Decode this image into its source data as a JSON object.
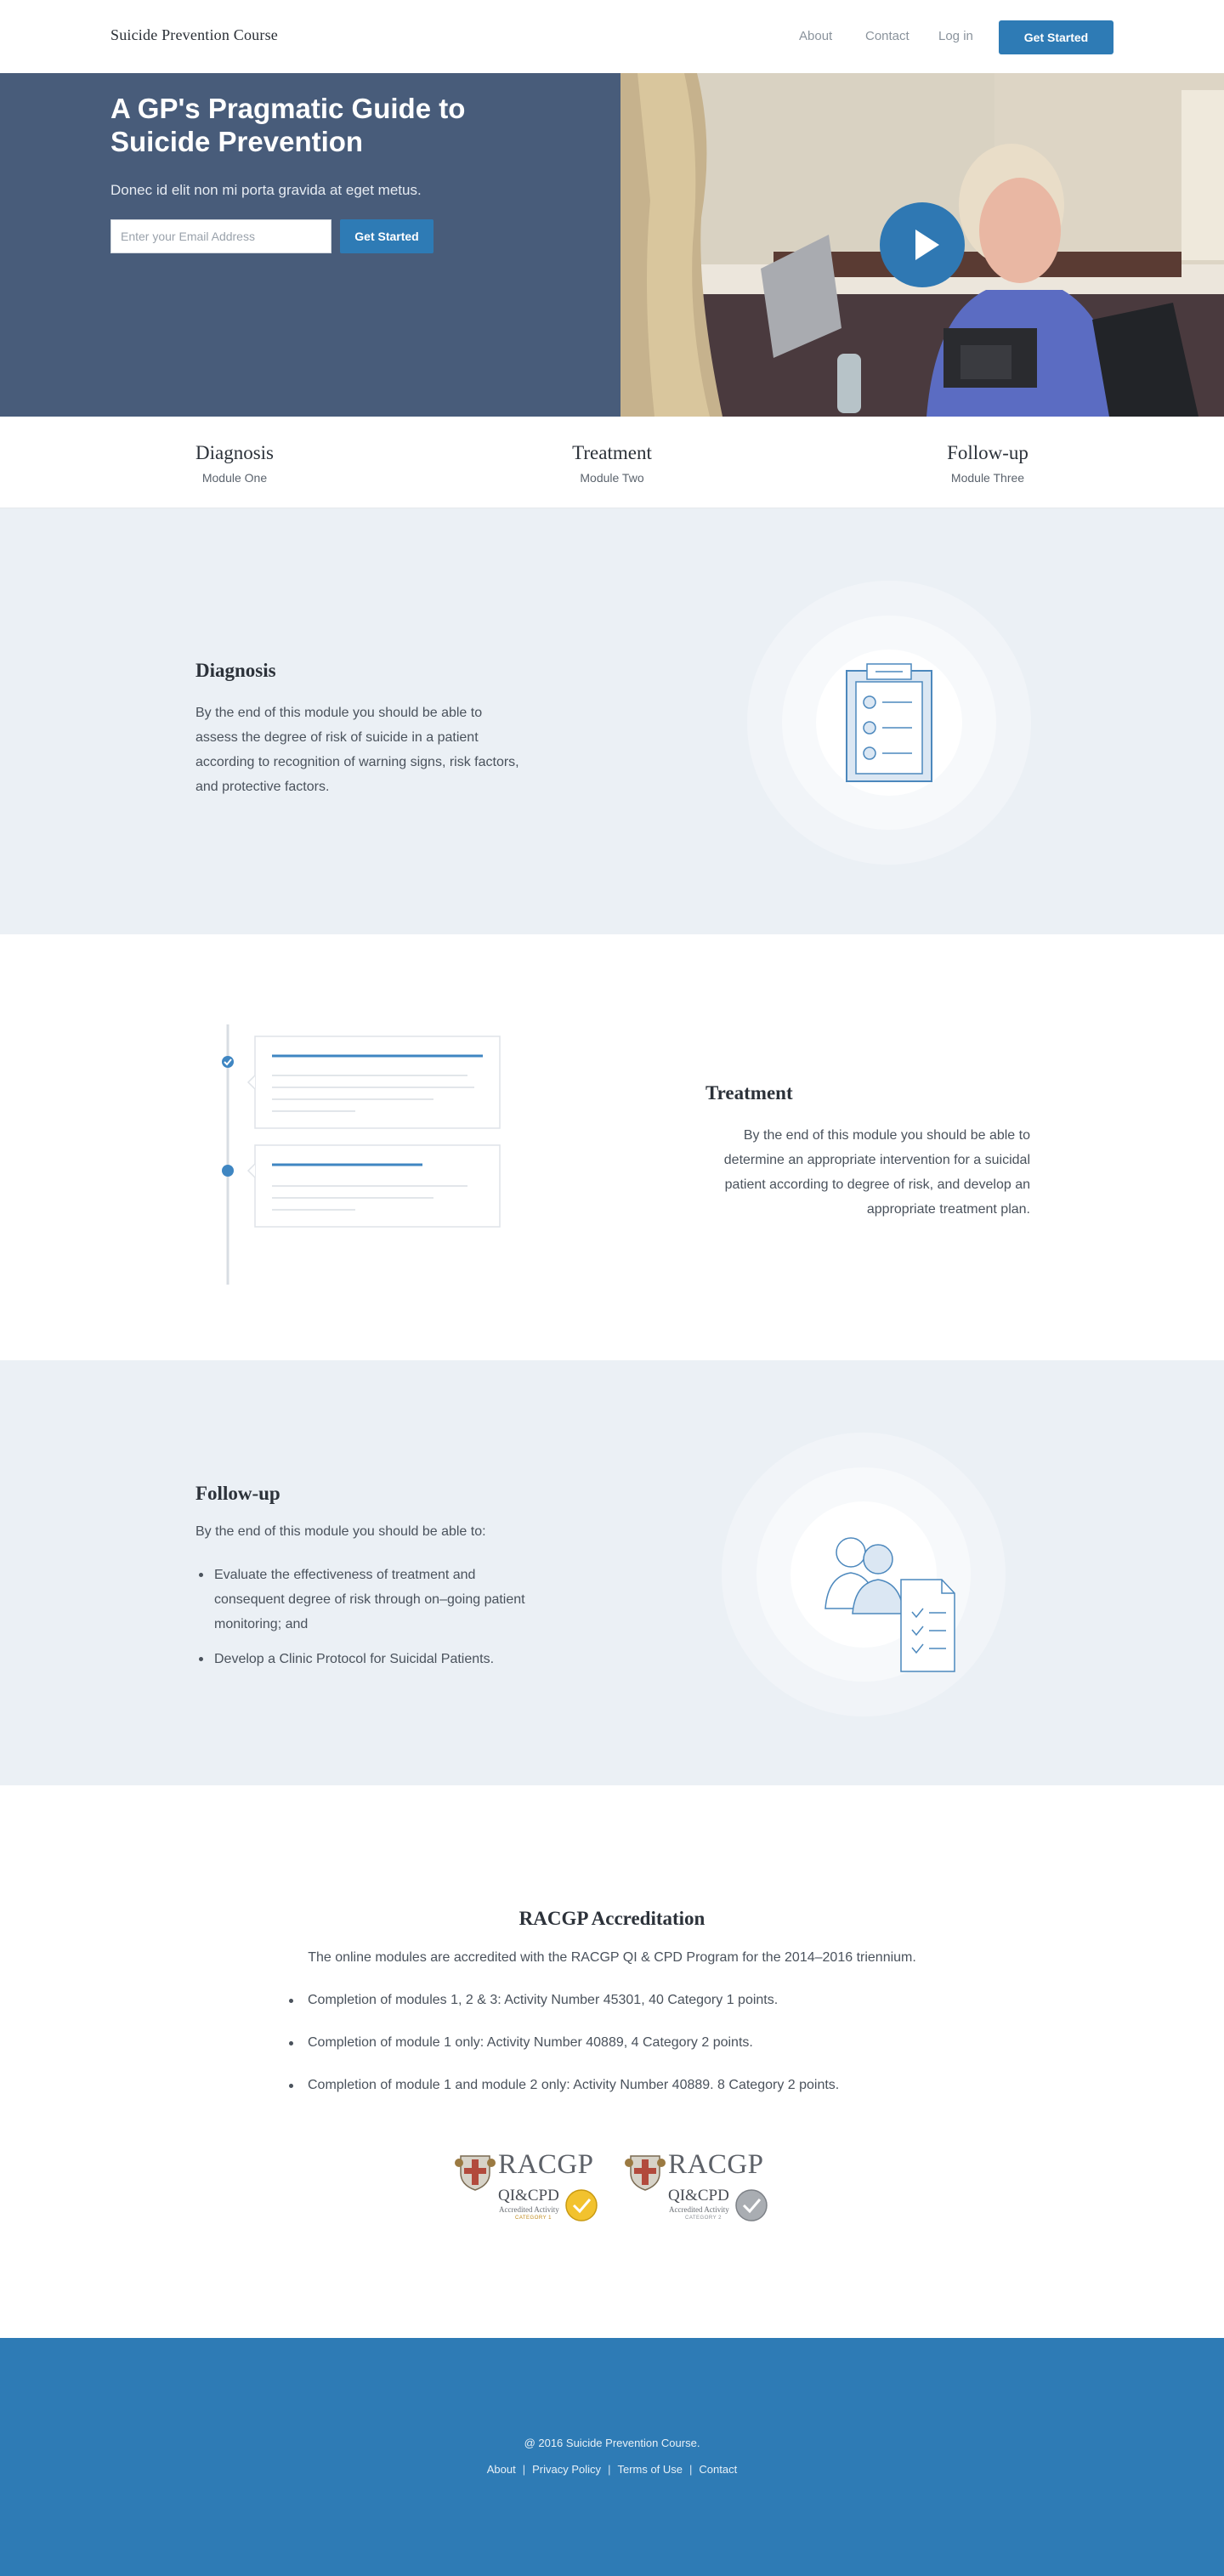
{
  "nav": {
    "brand": "Suicide Prevention Course",
    "links": [
      "About",
      "Contact",
      "Log in"
    ],
    "cta": "Get Started"
  },
  "hero": {
    "title": "A GP's Pragmatic Guide to Suicide Prevention",
    "subtitle": "Donec id elit non mi porta gravida at eget metus.",
    "email_placeholder": "Enter your Email Address",
    "cta": "Get Started"
  },
  "modules": [
    {
      "title": "Diagnosis",
      "sub": "Module One"
    },
    {
      "title": "Treatment",
      "sub": "Module Two"
    },
    {
      "title": "Follow-up",
      "sub": "Module Three"
    }
  ],
  "diagnosis": {
    "heading": "Diagnosis",
    "text": "By the end of this module you should be able to assess the degree of risk of suicide in a patient according to recognition of warning signs, risk factors, and protective factors."
  },
  "treatment": {
    "heading": "Treatment",
    "text": "By the end of this module you should be able to determine an appropriate intervention for a suicidal patient according to degree of risk, and develop an appropriate treatment plan."
  },
  "followup": {
    "heading": "Follow-up",
    "intro": "By the end of this module you should be able to:",
    "items": [
      "Evaluate the effectiveness of treatment and consequent degree of risk through on–going patient monitoring; and",
      "Develop a Clinic Protocol for Suicidal Patients."
    ]
  },
  "accreditation": {
    "heading": "RACGP Accreditation",
    "intro": "The online modules are accredited with the RACGP QI & CPD Program for the 2014–2016 triennium.",
    "items": [
      "Completion of modules 1, 2 & 3: Activity Number 45301, 40 Category 1 points.",
      "Completion of module 1 only: Activity Number 40889, 4 Category 2 points.",
      "Completion of module 1 and module 2 only: Activity Number 40889. 8 Category 2 points."
    ],
    "logos": [
      {
        "word": "RACGP",
        "program": "QI&CPD",
        "label": "Accredited Activity",
        "category": "CATEGORY 1",
        "badge_color": "#f2c22e"
      },
      {
        "word": "RACGP",
        "program": "QI&CPD",
        "label": "Accredited Activity",
        "category": "CATEGORY 2",
        "badge_color": "#a9adb2"
      }
    ]
  },
  "footer": {
    "copyright": "@ 2016 Suicide Prevention Course.",
    "links": [
      "About",
      "Privacy Policy",
      "Terms of Use",
      "Contact"
    ]
  },
  "colors": {
    "primary": "#2e7bb5",
    "hero_bg": "#485c7a",
    "section_bg": "#ebf0f5",
    "illustration": "#4c88bd"
  }
}
